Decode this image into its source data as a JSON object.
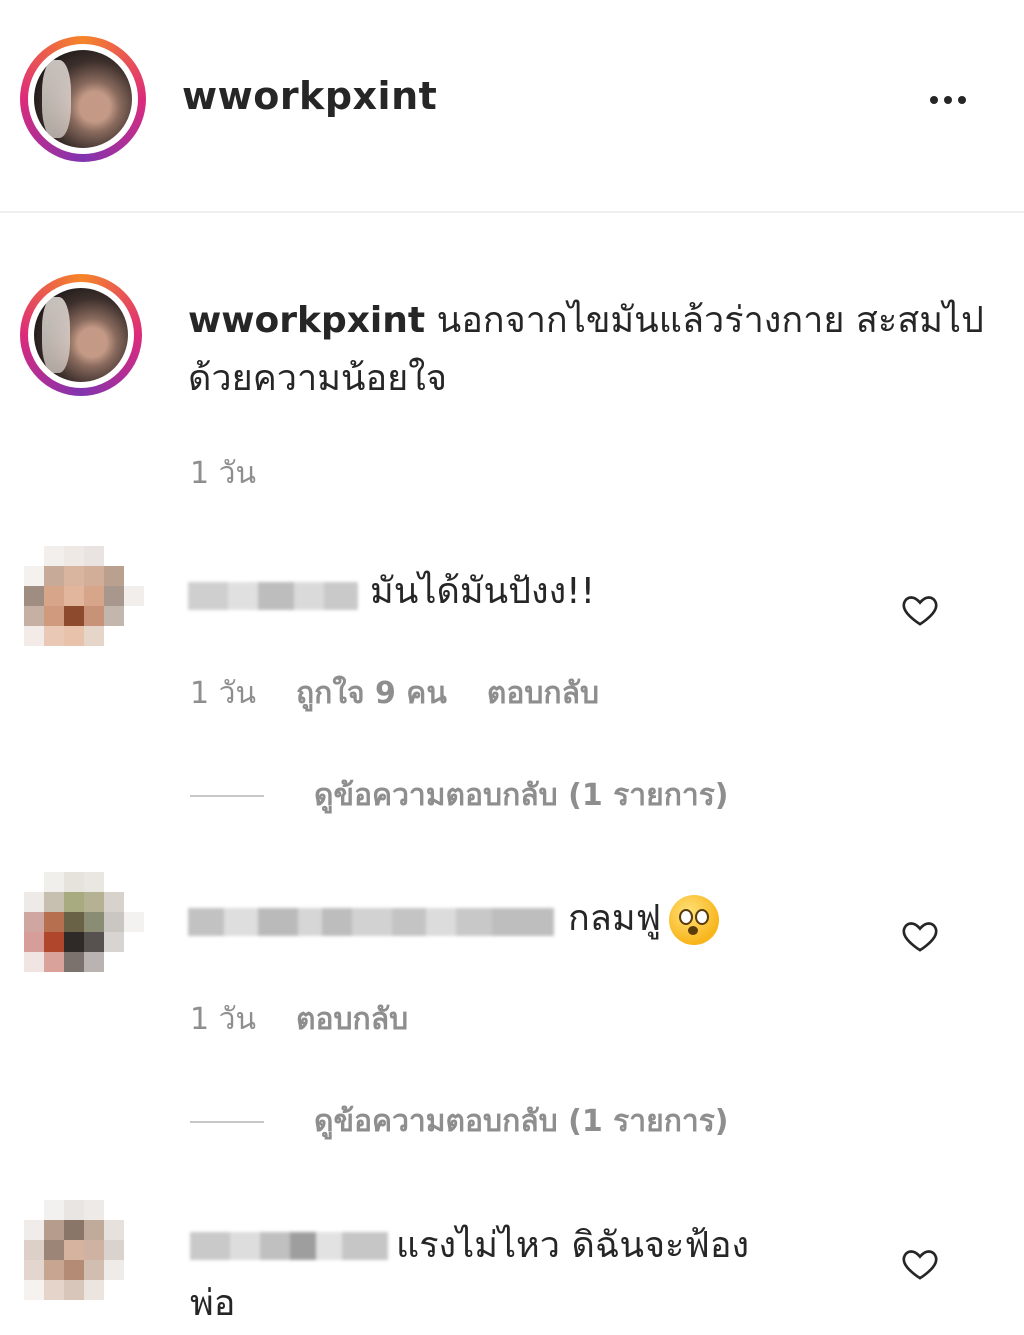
{
  "header": {
    "username": "wworkpxint",
    "more_icon": "more-horizontal-icon"
  },
  "caption": {
    "username": "wworkpxint",
    "text": "นอกจากไขมันแล้วร่างกาย สะสมไปด้วยความน้อยใจ",
    "time": "1 วัน"
  },
  "comments": [
    {
      "text": "มันได้มันปังง!!",
      "time": "1 วัน",
      "likes": "ถูกใจ 9 คน",
      "reply": "ตอบกลับ",
      "view_replies": "ดูข้อความตอบกลับ (1 รายการ)"
    },
    {
      "text": "กลมฟู",
      "emoji": "flushed-face-emoji",
      "time": "1 วัน",
      "reply": "ตอบกลับ",
      "view_replies": "ดูข้อความตอบกลับ (1 รายการ)"
    },
    {
      "text": "แรงไม่ไหว ดิฉันจะฟ้อง",
      "text2": "พ่อ"
    }
  ],
  "icons": {
    "like": "heart-outline-icon"
  },
  "colors": {
    "text": "#262626",
    "secondary": "#8e8e8e",
    "divider": "#efefef"
  }
}
